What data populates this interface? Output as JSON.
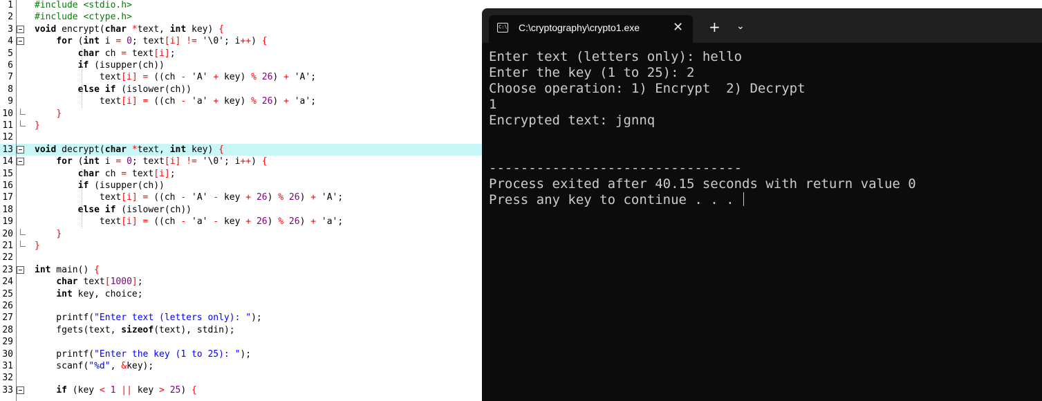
{
  "editor": {
    "lines": [
      {
        "n": "1",
        "segs": [
          {
            "c": "pp",
            "t": "#include <stdio.h>"
          }
        ]
      },
      {
        "n": "2",
        "segs": [
          {
            "c": "pp",
            "t": "#include <ctype.h>"
          }
        ]
      },
      {
        "n": "3",
        "segs": [
          {
            "c": "kw",
            "t": "void"
          },
          {
            "c": "",
            "t": " encrypt("
          },
          {
            "c": "kw",
            "t": "char"
          },
          {
            "c": "",
            "t": " "
          },
          {
            "c": "sy",
            "t": "*"
          },
          {
            "c": "",
            "t": "text, "
          },
          {
            "c": "kw",
            "t": "int"
          },
          {
            "c": "",
            "t": " key) "
          },
          {
            "c": "sy",
            "t": "{"
          }
        ]
      },
      {
        "n": "4",
        "segs": [
          {
            "c": "",
            "t": "    "
          },
          {
            "c": "kw",
            "t": "for"
          },
          {
            "c": "",
            "t": " ("
          },
          {
            "c": "kw",
            "t": "int"
          },
          {
            "c": "",
            "t": " i "
          },
          {
            "c": "sy",
            "t": "="
          },
          {
            "c": "",
            "t": " "
          },
          {
            "c": "num",
            "t": "0"
          },
          {
            "c": "",
            "t": "; text"
          },
          {
            "c": "sy",
            "t": "[i]"
          },
          {
            "c": "",
            "t": " "
          },
          {
            "c": "sy",
            "t": "!="
          },
          {
            "c": "",
            "t": " '\\0'; i"
          },
          {
            "c": "sy",
            "t": "++"
          },
          {
            "c": "",
            "t": ") "
          },
          {
            "c": "sy",
            "t": "{"
          }
        ]
      },
      {
        "n": "5",
        "segs": [
          {
            "c": "",
            "t": "        "
          },
          {
            "c": "kw",
            "t": "char"
          },
          {
            "c": "",
            "t": " ch "
          },
          {
            "c": "sy",
            "t": "="
          },
          {
            "c": "",
            "t": " text"
          },
          {
            "c": "sy",
            "t": "[i]"
          },
          {
            "c": "",
            "t": ";"
          }
        ]
      },
      {
        "n": "6",
        "segs": [
          {
            "c": "",
            "t": "        "
          },
          {
            "c": "kw",
            "t": "if"
          },
          {
            "c": "",
            "t": " (isupper(ch))"
          }
        ]
      },
      {
        "n": "7",
        "segs": [
          {
            "c": "",
            "t": "            text"
          },
          {
            "c": "sy",
            "t": "[i]"
          },
          {
            "c": "",
            "t": " "
          },
          {
            "c": "sy",
            "t": "="
          },
          {
            "c": "",
            "t": " ((ch "
          },
          {
            "c": "sy",
            "t": "-"
          },
          {
            "c": "",
            "t": " 'A' "
          },
          {
            "c": "sy",
            "t": "+"
          },
          {
            "c": "",
            "t": " key) "
          },
          {
            "c": "sy",
            "t": "%"
          },
          {
            "c": "",
            "t": " "
          },
          {
            "c": "num",
            "t": "26"
          },
          {
            "c": "",
            "t": ") "
          },
          {
            "c": "sy",
            "t": "+"
          },
          {
            "c": "",
            "t": " 'A';"
          }
        ]
      },
      {
        "n": "8",
        "segs": [
          {
            "c": "",
            "t": "        "
          },
          {
            "c": "kw",
            "t": "else if"
          },
          {
            "c": "",
            "t": " (islower(ch))"
          }
        ]
      },
      {
        "n": "9",
        "segs": [
          {
            "c": "",
            "t": "            text"
          },
          {
            "c": "sy",
            "t": "[i]"
          },
          {
            "c": "",
            "t": " "
          },
          {
            "c": "sy",
            "t": "="
          },
          {
            "c": "",
            "t": " ((ch "
          },
          {
            "c": "sy",
            "t": "-"
          },
          {
            "c": "",
            "t": " 'a' "
          },
          {
            "c": "sy",
            "t": "+"
          },
          {
            "c": "",
            "t": " key) "
          },
          {
            "c": "sy",
            "t": "%"
          },
          {
            "c": "",
            "t": " "
          },
          {
            "c": "num",
            "t": "26"
          },
          {
            "c": "",
            "t": ") "
          },
          {
            "c": "sy",
            "t": "+"
          },
          {
            "c": "",
            "t": " 'a';"
          }
        ]
      },
      {
        "n": "10",
        "segs": [
          {
            "c": "",
            "t": "    "
          },
          {
            "c": "sy",
            "t": "}"
          }
        ]
      },
      {
        "n": "11",
        "segs": [
          {
            "c": "sy",
            "t": "}"
          }
        ]
      },
      {
        "n": "12",
        "segs": []
      },
      {
        "n": "13",
        "segs": [
          {
            "c": "kw",
            "t": "void"
          },
          {
            "c": "",
            "t": " decrypt("
          },
          {
            "c": "kw",
            "t": "char"
          },
          {
            "c": "",
            "t": " "
          },
          {
            "c": "sy",
            "t": "*"
          },
          {
            "c": "",
            "t": "text, "
          },
          {
            "c": "kw",
            "t": "int"
          },
          {
            "c": "",
            "t": " key) "
          },
          {
            "c": "sy",
            "t": "{"
          }
        ]
      },
      {
        "n": "14",
        "segs": [
          {
            "c": "",
            "t": "    "
          },
          {
            "c": "kw",
            "t": "for"
          },
          {
            "c": "",
            "t": " ("
          },
          {
            "c": "kw",
            "t": "int"
          },
          {
            "c": "",
            "t": " i "
          },
          {
            "c": "sy",
            "t": "="
          },
          {
            "c": "",
            "t": " "
          },
          {
            "c": "num",
            "t": "0"
          },
          {
            "c": "",
            "t": "; text"
          },
          {
            "c": "sy",
            "t": "[i]"
          },
          {
            "c": "",
            "t": " "
          },
          {
            "c": "sy",
            "t": "!="
          },
          {
            "c": "",
            "t": " '\\0'; i"
          },
          {
            "c": "sy",
            "t": "++"
          },
          {
            "c": "",
            "t": ") "
          },
          {
            "c": "sy",
            "t": "{"
          }
        ]
      },
      {
        "n": "15",
        "segs": [
          {
            "c": "",
            "t": "        "
          },
          {
            "c": "kw",
            "t": "char"
          },
          {
            "c": "",
            "t": " ch "
          },
          {
            "c": "sy",
            "t": "="
          },
          {
            "c": "",
            "t": " text"
          },
          {
            "c": "sy",
            "t": "[i]"
          },
          {
            "c": "",
            "t": ";"
          }
        ]
      },
      {
        "n": "16",
        "segs": [
          {
            "c": "",
            "t": "        "
          },
          {
            "c": "kw",
            "t": "if"
          },
          {
            "c": "",
            "t": " (isupper(ch))"
          }
        ]
      },
      {
        "n": "17",
        "segs": [
          {
            "c": "",
            "t": "            text"
          },
          {
            "c": "sy",
            "t": "[i]"
          },
          {
            "c": "",
            "t": " "
          },
          {
            "c": "sy",
            "t": "="
          },
          {
            "c": "",
            "t": " ((ch "
          },
          {
            "c": "sy",
            "t": "-"
          },
          {
            "c": "",
            "t": " 'A' "
          },
          {
            "c": "sy",
            "t": "-"
          },
          {
            "c": "",
            "t": " key "
          },
          {
            "c": "sy",
            "t": "+"
          },
          {
            "c": "",
            "t": " "
          },
          {
            "c": "num",
            "t": "26"
          },
          {
            "c": "",
            "t": ") "
          },
          {
            "c": "sy",
            "t": "%"
          },
          {
            "c": "",
            "t": " "
          },
          {
            "c": "num",
            "t": "26"
          },
          {
            "c": "",
            "t": ") "
          },
          {
            "c": "sy",
            "t": "+"
          },
          {
            "c": "",
            "t": " 'A';"
          }
        ]
      },
      {
        "n": "18",
        "segs": [
          {
            "c": "",
            "t": "        "
          },
          {
            "c": "kw",
            "t": "else if"
          },
          {
            "c": "",
            "t": " (islower(ch))"
          }
        ]
      },
      {
        "n": "19",
        "segs": [
          {
            "c": "",
            "t": "            text"
          },
          {
            "c": "sy",
            "t": "[i]"
          },
          {
            "c": "",
            "t": " "
          },
          {
            "c": "sy",
            "t": "="
          },
          {
            "c": "",
            "t": " ((ch "
          },
          {
            "c": "sy",
            "t": "-"
          },
          {
            "c": "",
            "t": " 'a' "
          },
          {
            "c": "sy",
            "t": "-"
          },
          {
            "c": "",
            "t": " key "
          },
          {
            "c": "sy",
            "t": "+"
          },
          {
            "c": "",
            "t": " "
          },
          {
            "c": "num",
            "t": "26"
          },
          {
            "c": "",
            "t": ") "
          },
          {
            "c": "sy",
            "t": "%"
          },
          {
            "c": "",
            "t": " "
          },
          {
            "c": "num",
            "t": "26"
          },
          {
            "c": "",
            "t": ") "
          },
          {
            "c": "sy",
            "t": "+"
          },
          {
            "c": "",
            "t": " 'a';"
          }
        ]
      },
      {
        "n": "20",
        "segs": [
          {
            "c": "",
            "t": "    "
          },
          {
            "c": "sy",
            "t": "}"
          }
        ]
      },
      {
        "n": "21",
        "segs": [
          {
            "c": "sy",
            "t": "}"
          }
        ]
      },
      {
        "n": "22",
        "segs": []
      },
      {
        "n": "23",
        "segs": [
          {
            "c": "kw",
            "t": "int"
          },
          {
            "c": "",
            "t": " main() "
          },
          {
            "c": "sy",
            "t": "{"
          }
        ]
      },
      {
        "n": "24",
        "segs": [
          {
            "c": "",
            "t": "    "
          },
          {
            "c": "kw",
            "t": "char"
          },
          {
            "c": "",
            "t": " text"
          },
          {
            "c": "sy",
            "t": "["
          },
          {
            "c": "num",
            "t": "1000"
          },
          {
            "c": "sy",
            "t": "]"
          },
          {
            "c": "",
            "t": ";"
          }
        ]
      },
      {
        "n": "25",
        "segs": [
          {
            "c": "",
            "t": "    "
          },
          {
            "c": "kw",
            "t": "int"
          },
          {
            "c": "",
            "t": " key, choice;"
          }
        ]
      },
      {
        "n": "26",
        "segs": []
      },
      {
        "n": "27",
        "segs": [
          {
            "c": "",
            "t": "    printf("
          },
          {
            "c": "str",
            "t": "\"Enter text (letters only): \""
          },
          {
            "c": "",
            "t": ");"
          }
        ]
      },
      {
        "n": "28",
        "segs": [
          {
            "c": "",
            "t": "    fgets(text, "
          },
          {
            "c": "kw",
            "t": "sizeof"
          },
          {
            "c": "",
            "t": "(text), stdin);"
          }
        ]
      },
      {
        "n": "29",
        "segs": []
      },
      {
        "n": "30",
        "segs": [
          {
            "c": "",
            "t": "    printf("
          },
          {
            "c": "str",
            "t": "\"Enter the key (1 to 25): \""
          },
          {
            "c": "",
            "t": ");"
          }
        ]
      },
      {
        "n": "31",
        "segs": [
          {
            "c": "",
            "t": "    scanf("
          },
          {
            "c": "str",
            "t": "\"%d\""
          },
          {
            "c": "",
            "t": ", "
          },
          {
            "c": "sy",
            "t": "&"
          },
          {
            "c": "",
            "t": "key);"
          }
        ]
      },
      {
        "n": "32",
        "segs": []
      },
      {
        "n": "33",
        "segs": [
          {
            "c": "",
            "t": "    "
          },
          {
            "c": "kw",
            "t": "if"
          },
          {
            "c": "",
            "t": " (key "
          },
          {
            "c": "sy",
            "t": "<"
          },
          {
            "c": "",
            "t": " "
          },
          {
            "c": "num",
            "t": "1"
          },
          {
            "c": "",
            "t": " "
          },
          {
            "c": "sy",
            "t": "||"
          },
          {
            "c": "",
            "t": " key "
          },
          {
            "c": "sy",
            "t": ">"
          },
          {
            "c": "",
            "t": " "
          },
          {
            "c": "num",
            "t": "25"
          },
          {
            "c": "",
            "t": ") "
          },
          {
            "c": "sy",
            "t": "{"
          }
        ]
      }
    ]
  },
  "terminal": {
    "tab_title": "C:\\cryptography\\crypto1.exe",
    "tab_icon_text": "C:\\",
    "close_glyph": "✕",
    "new_tab_glyph": "+",
    "dropdown_glyph": "⌄",
    "output": [
      "Enter text (letters only): hello",
      "Enter the key (1 to 25): 2",
      "Choose operation: 1) Encrypt  2) Decrypt",
      "1",
      "Encrypted text: jgnnq",
      "",
      "",
      "--------------------------------",
      "Process exited after 40.15 seconds with return value 0",
      "Press any key to continue . . . "
    ]
  }
}
